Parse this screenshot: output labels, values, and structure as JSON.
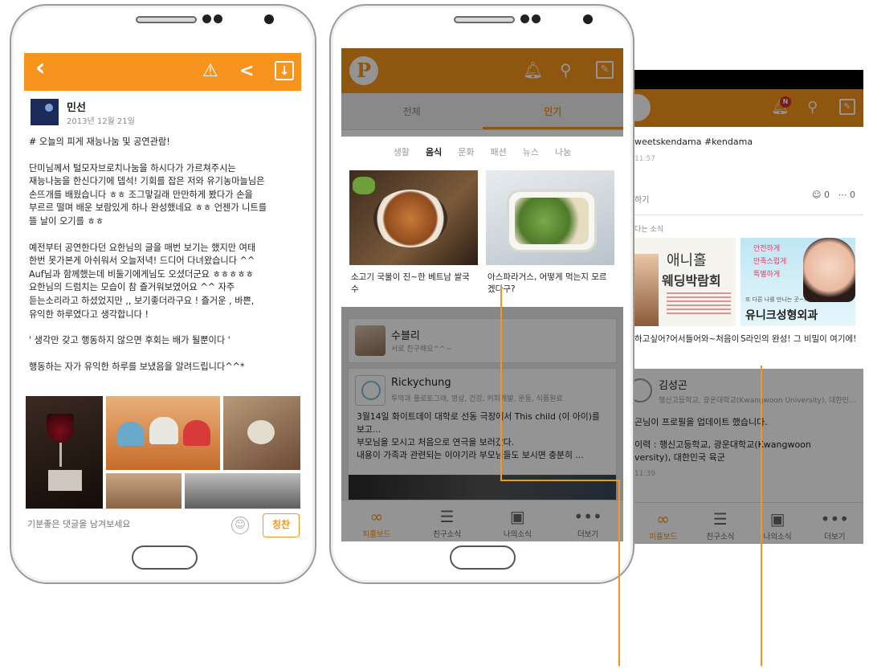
{
  "post_detail": {
    "back_icon": "chevron-left-icon",
    "author_name": "민선",
    "post_date": "2013년 12월 21일",
    "body_lines": [
      "# 오늘의 피게 재능나눔 및 공연관람!",
      "",
      "단미님께서 털모자브로치나눔을 하시다가 가르쳐주시는",
      "재능나눔을 한신다기에 뎁석! 기회를 잡은 저와 유기농마늘님은",
      "손뜨개를 배웠습니다 ㅎㅎ 조그맣길래 만만하게 봤다가 손을",
      "부르르 떨며 배운 보람있게 하나 완성했네요 ㅎㅎ 언젠가 니트를",
      "뜰 날이 오기를 ㅎㅎ",
      "",
      "예전부터 공연한다던 요한님의 글을 매번 보기는 했지만 여태",
      "한번 못가본게 아쉬워서 오늘저녁! 드디어 다녀왔습니다 ^^",
      "Auf님과 함께했는데 비둘기에게님도 오셨더군요 ㅎㅎㅎㅎㅎ",
      "요한님의 드럼치는 모습이 참 즐거워보였어요 ^^ 자주",
      "듣는소리라고 하셨었지만 ,, 보기좋더라구요 ! 즐거운 , 바쁜,",
      "유익한 하루였다고 생각합니다 !",
      "",
      "' 생각만 갖고 행동하지 않으면 후회는 배가 될뿐이다 '",
      "",
      "행동하는 자가 유익한 하루를 보냈음을 알려드립니다^^*"
    ],
    "comment_placeholder": "기분좋은 댓글을 남겨보세요",
    "praise_label": "칭찬"
  },
  "popular_feed": {
    "logo": "P",
    "tabs": [
      "전체",
      "인기"
    ],
    "active_tab": "인기",
    "categories": [
      "생활",
      "음식",
      "문화",
      "패션",
      "뉴스",
      "나눔"
    ],
    "active_category": "음식",
    "cards": [
      {
        "caption": "소고기 국물이 진~한 베트남 쌀국수"
      },
      {
        "caption": "아스파라거스, 어떻게 먹는지 모르겠다구?"
      }
    ],
    "feed": [
      {
        "name": "수블리",
        "sub": "서로 친구해요^^~"
      },
      {
        "name": "Rickychung",
        "sub": "투막과 플로토그래, 영상, 건강, 커피개발, 운동, 식품원료",
        "text": [
          "3월14일 화이트데이 대학로 선동 극장에서 This child (이 아이)를",
          "보고...",
          "부모님을 모시고 처음으로 연극을 보러갔다.",
          "내용이 가족과 관련되는 이야기라 부모님들도 보시면 충분히 ..."
        ]
      }
    ],
    "nav": [
      {
        "label": "피플보드",
        "icon": "link-icon"
      },
      {
        "label": "친구소식",
        "icon": "list-icon"
      },
      {
        "label": "나의소식",
        "icon": "contact-icon"
      },
      {
        "label": "더보기",
        "icon": "more-icon"
      }
    ],
    "active_nav": "피플보드"
  },
  "friend_feed": {
    "notification_count": "N",
    "post_tag": "weetskendama #kendama",
    "post_time": "11:57",
    "post_action": "하기",
    "smile_count": "0",
    "comment_count": "0",
    "section_label": "다는 소식",
    "ad_left_title": [
      "애니홀",
      "웨딩박람회"
    ],
    "ad_left_caption": "하고싶어?어서들어와~처음이",
    "ad_right_slogans": [
      "안전하게",
      "만족스럽게",
      "특별하게"
    ],
    "ad_right_tagline": "또 다른 나를 만나는 곳~!",
    "ad_right_brand": "유니크성형외과",
    "ad_right_caption": "S라인의 완성! 그 비밀이 여기에!",
    "post2_name": "김성곤",
    "post2_sub": "행신고등학교, 광운대학교(Kwangwoon University), 대한민...",
    "post2_lines": [
      "곤님이 프로필을 업데이트 했습니다.",
      "이력 : 행신고등학교, 광운대학교(Kwangwoon",
      "versity), 대한민국 육군"
    ],
    "post2_time": "11:39",
    "nav": [
      "피플보드",
      "친구소식",
      "나의소식",
      "더보기"
    ]
  },
  "colors": {
    "accent": "#f7941d",
    "overlay": "rgba(0,0,0,0.42)"
  }
}
